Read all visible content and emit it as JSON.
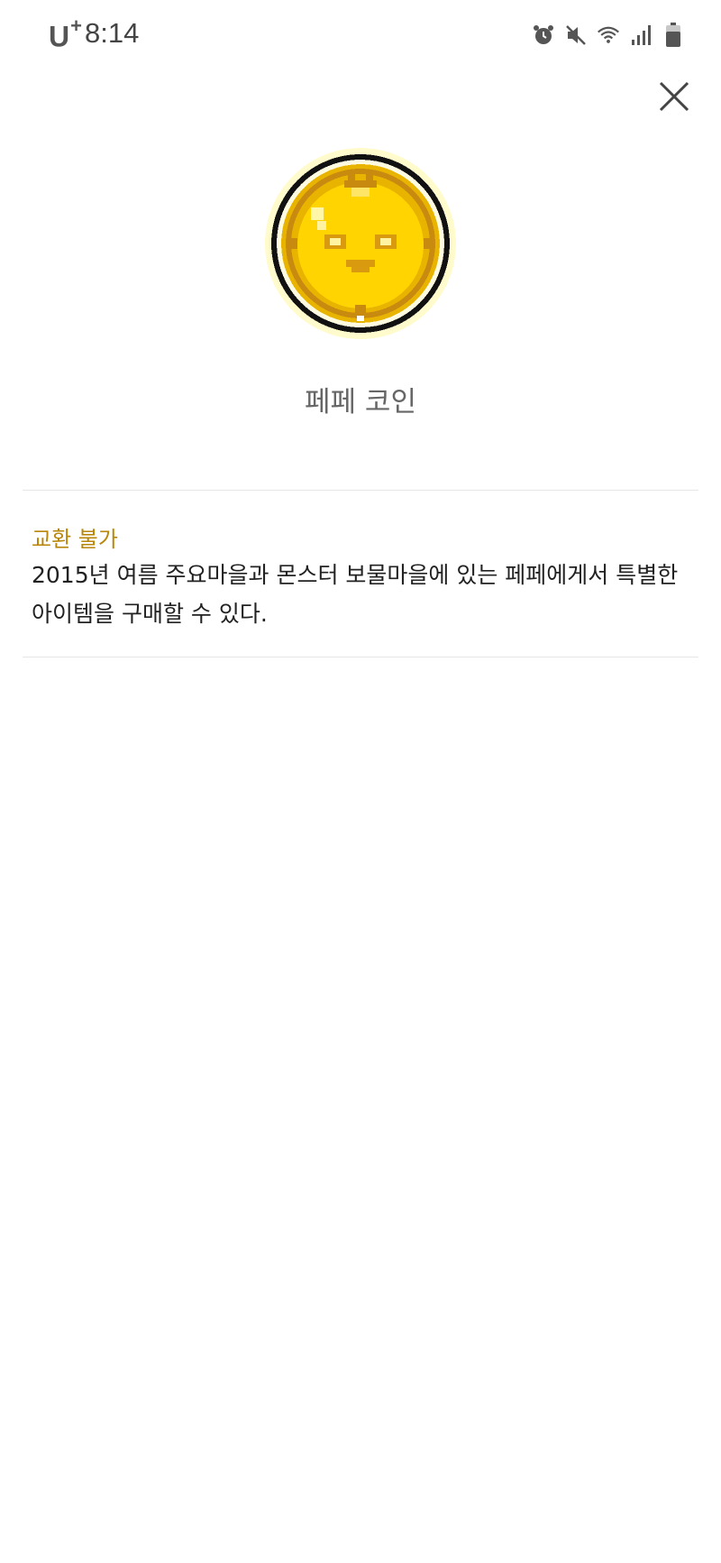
{
  "status_bar": {
    "carrier": "U",
    "carrier_plus": "+",
    "time": "8:14",
    "icons": [
      "alarm-icon",
      "mute-icon",
      "wifi-icon",
      "signal-icon",
      "battery-icon"
    ]
  },
  "item": {
    "name": "페페 코인",
    "icon": "pepe-coin-icon",
    "tag": "교환 불가",
    "description": "2015년 여름 주요마을과 몬스터 보물마을에 있는 페페에게서 특별한 아이템을 구매할 수 있다."
  },
  "colors": {
    "tag": "#b8860b",
    "name": "#666666",
    "text": "#222222",
    "coin_gold": "#f5c800"
  }
}
